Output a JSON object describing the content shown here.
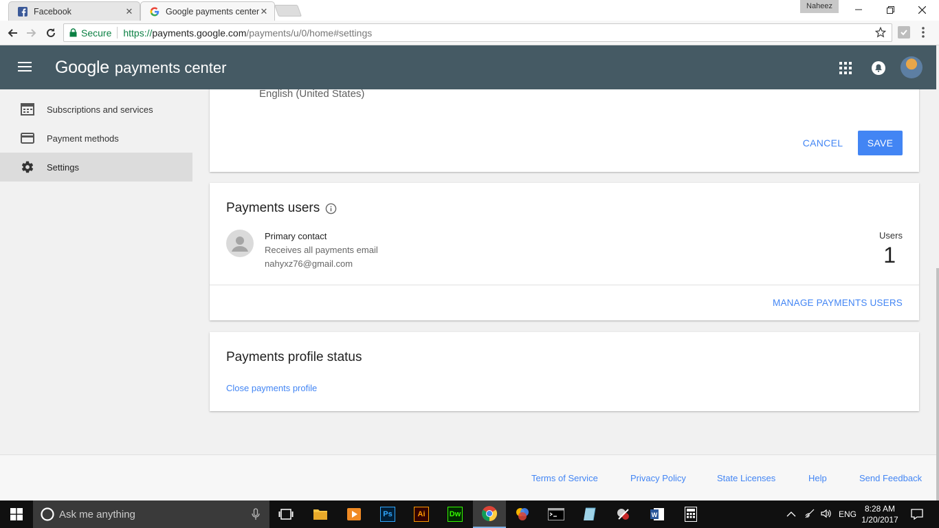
{
  "browser": {
    "tabs": [
      {
        "label": "Facebook",
        "icon": "facebook-icon"
      },
      {
        "label": "Google payments center",
        "icon": "google-icon"
      }
    ],
    "profile_name": "Naheez",
    "secure_label": "Secure",
    "url": {
      "scheme": "https://",
      "host": "payments.google.com",
      "path": "/payments/u/0/home#settings"
    }
  },
  "header": {
    "google": "Google",
    "product": "payments center"
  },
  "sidebar": {
    "items": [
      {
        "label": "Subscriptions and services",
        "icon": "subscriptions-icon"
      },
      {
        "label": "Payment methods",
        "icon": "credit-card-icon"
      },
      {
        "label": "Settings",
        "icon": "gear-icon",
        "active": true
      }
    ]
  },
  "language_card": {
    "language": "English (United States)",
    "cancel_label": "CANCEL",
    "save_label": "SAVE"
  },
  "users_card": {
    "title": "Payments users",
    "contact_name": "Primary contact",
    "contact_desc": "Receives all payments email",
    "contact_email": "nahyxz76@gmail.com",
    "users_label": "Users",
    "users_count": "1",
    "manage_label": "MANAGE PAYMENTS USERS"
  },
  "status_card": {
    "title": "Payments profile status",
    "close_label": "Close payments profile"
  },
  "footer": {
    "links": [
      "Terms of Service",
      "Privacy Policy",
      "State Licenses",
      "Help",
      "Send Feedback"
    ]
  },
  "taskbar": {
    "search_placeholder": "Ask me anything",
    "language": "ENG",
    "time": "8:28 AM",
    "date": "1/20/2017"
  },
  "colors": {
    "appbar": "#455a64",
    "accent": "#4285f4",
    "secure": "#0b8043"
  }
}
